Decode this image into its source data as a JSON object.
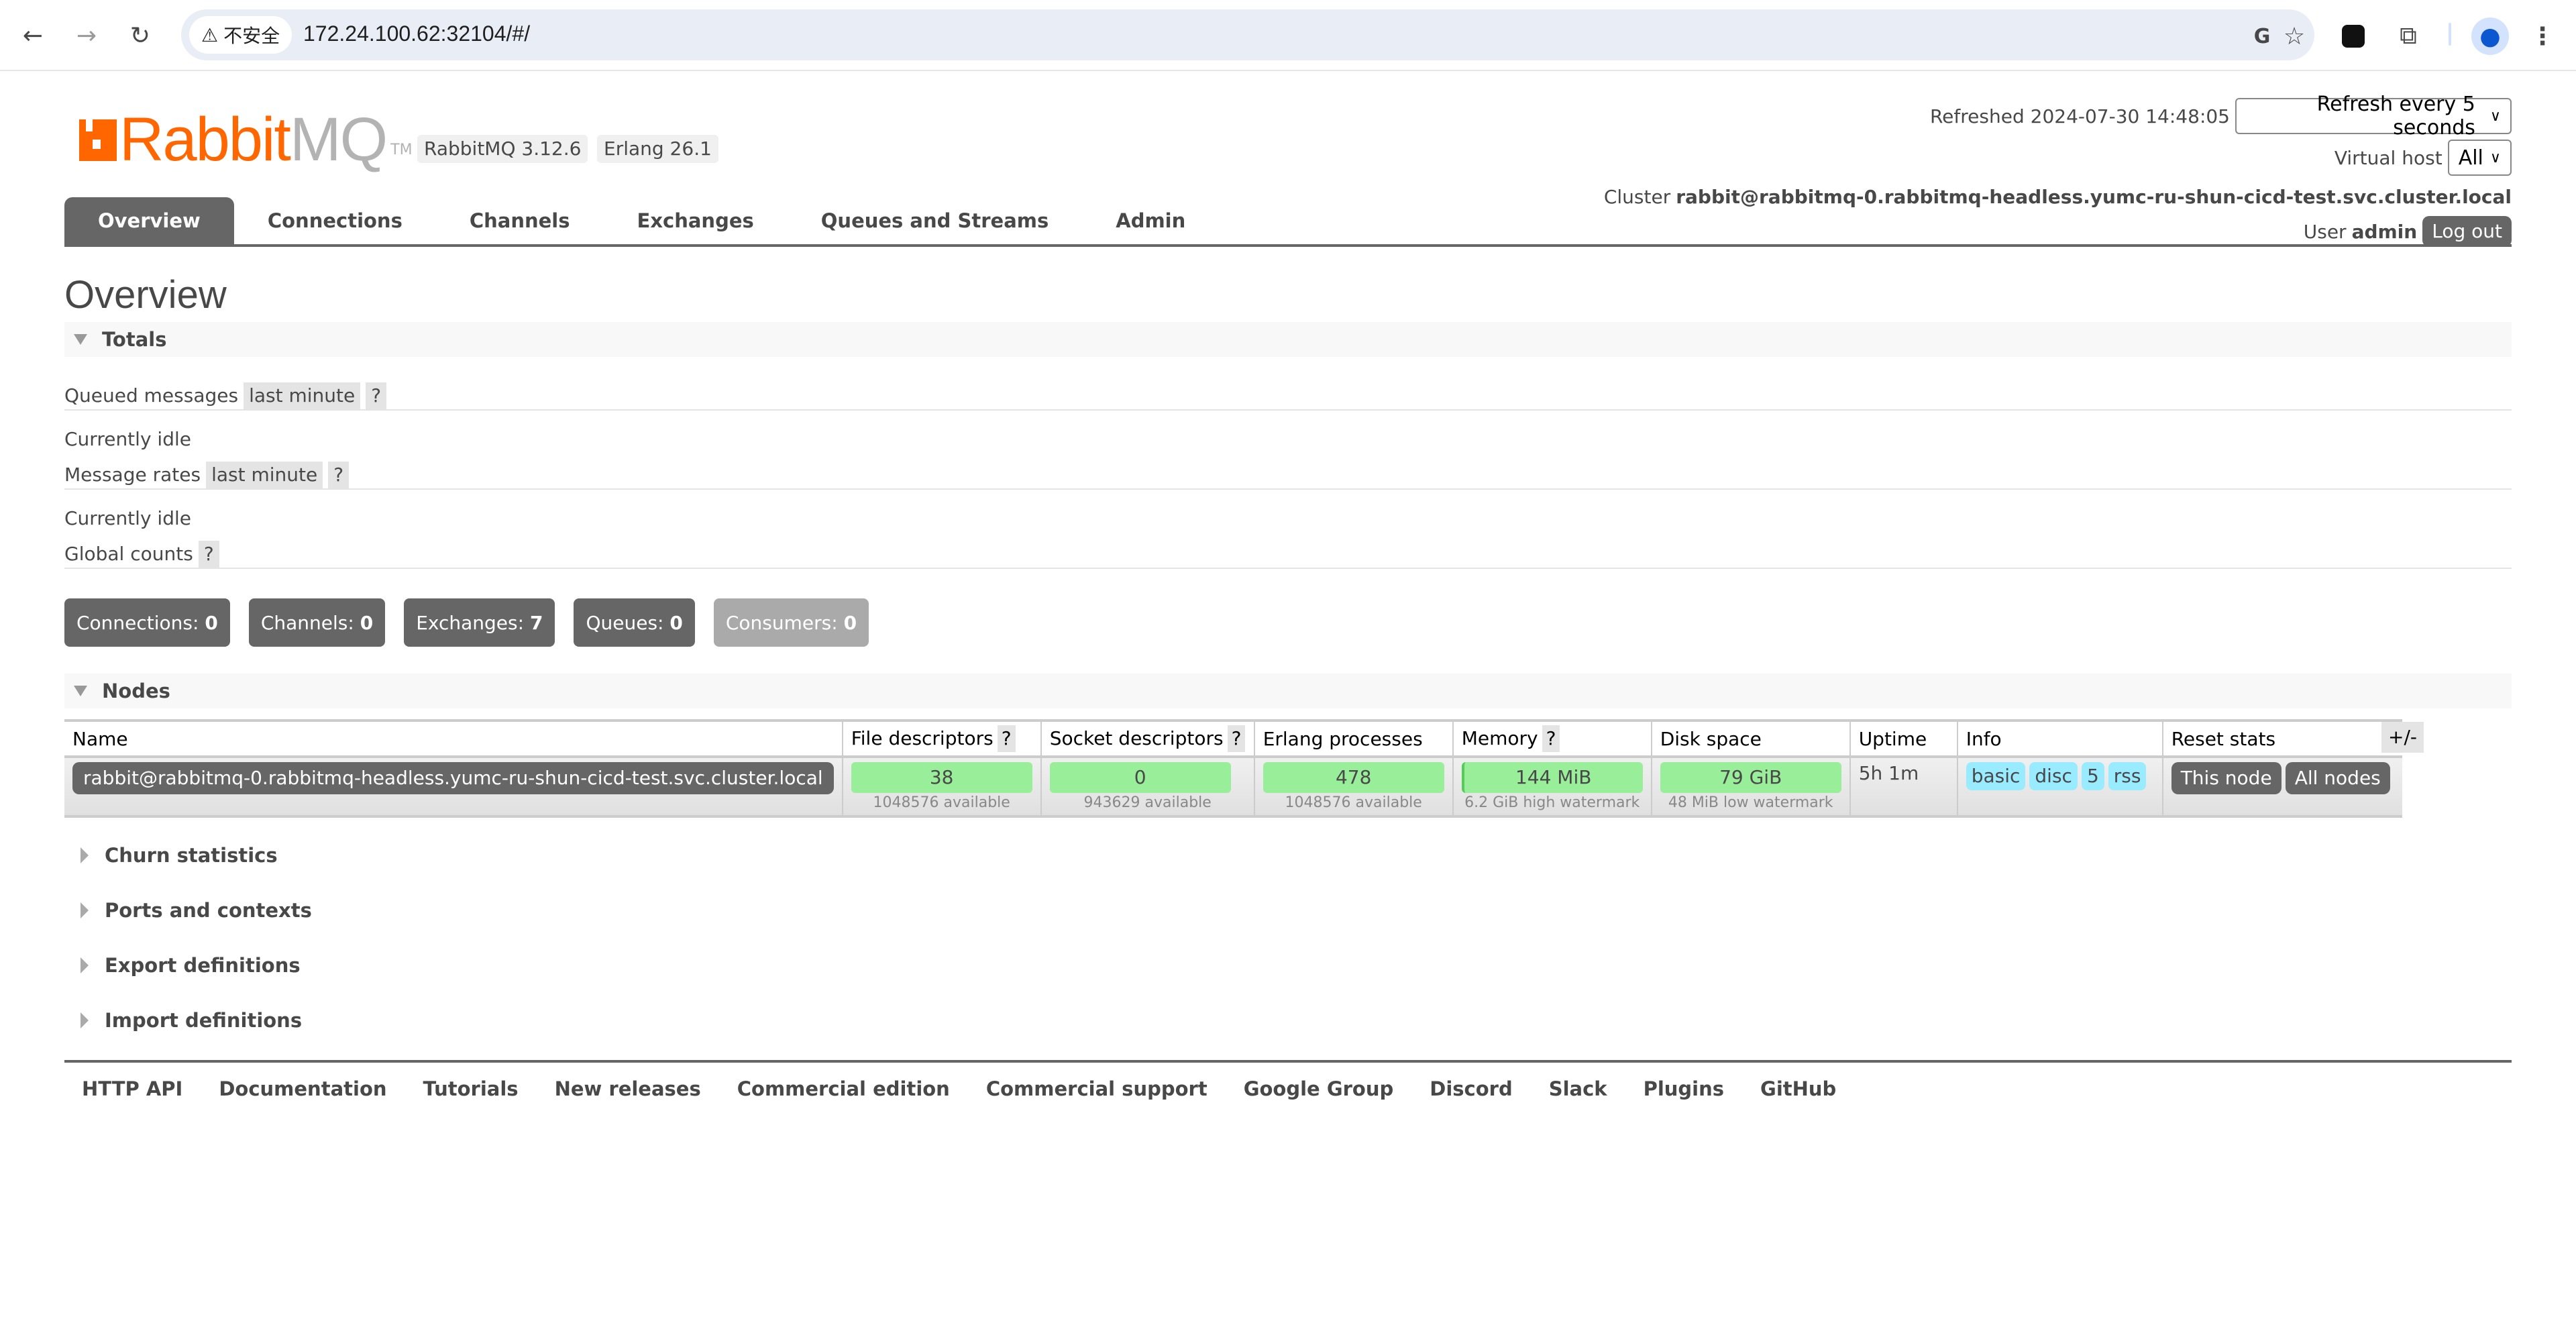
{
  "browser": {
    "security_label": "不安全",
    "url": "172.24.100.62:32104/#/",
    "icons": [
      "back-icon",
      "forward-icon",
      "reload-icon",
      "warning-icon",
      "translate-icon",
      "bookmark-star-icon",
      "extension-app-icon",
      "extensions-puzzle-icon",
      "profile-icon",
      "menu-dots-icon"
    ]
  },
  "header": {
    "logo_rabbit": "Rabbit",
    "logo_mq": "MQ",
    "logo_tm": "TM",
    "version_rabbitmq": "RabbitMQ 3.12.6",
    "version_erlang": "Erlang 26.1",
    "refreshed_label": "Refreshed 2024-07-30 14:48:05",
    "refresh_select": "Refresh every 5 seconds",
    "vhost_label": "Virtual host",
    "vhost_select": "All",
    "cluster_label": "Cluster",
    "cluster_name": "rabbit@rabbitmq-0.rabbitmq-headless.yumc-ru-shun-cicd-test.svc.cluster.local",
    "user_label": "User",
    "user_name": "admin",
    "logout_label": "Log out"
  },
  "tabs": [
    {
      "label": "Overview",
      "active": true
    },
    {
      "label": "Connections"
    },
    {
      "label": "Channels"
    },
    {
      "label": "Exchanges"
    },
    {
      "label": "Queues and Streams"
    },
    {
      "label": "Admin"
    }
  ],
  "page_title": "Overview",
  "totals": {
    "title": "Totals",
    "queued_messages_label": "Queued messages",
    "queued_messages_range": "last minute",
    "help": "?",
    "queued_status": "Currently idle",
    "message_rates_label": "Message rates",
    "message_rates_range": "last minute",
    "rates_status": "Currently idle",
    "global_counts_label": "Global counts",
    "counts": [
      {
        "label": "Connections:",
        "value": "0"
      },
      {
        "label": "Channels:",
        "value": "0"
      },
      {
        "label": "Exchanges:",
        "value": "7"
      },
      {
        "label": "Queues:",
        "value": "0"
      },
      {
        "label": "Consumers:",
        "value": "0"
      }
    ]
  },
  "nodes": {
    "title": "Nodes",
    "columns": [
      "Name",
      "File descriptors",
      "Socket descriptors",
      "Erlang processes",
      "Memory",
      "Disk space",
      "Uptime",
      "Info",
      "Reset stats"
    ],
    "toggle_columns": "+/-",
    "rows": [
      {
        "name": "rabbit@rabbitmq-0.rabbitmq-headless.yumc-ru-shun-cicd-test.svc.cluster.local",
        "file_descriptors": "38",
        "file_descriptors_sub": "1048576 available",
        "socket_descriptors": "0",
        "socket_descriptors_sub": "943629 available",
        "erlang_processes": "478",
        "erlang_processes_sub": "1048576 available",
        "memory": "144 MiB",
        "memory_sub": "6.2 GiB high watermark",
        "disk_space": "79 GiB",
        "disk_space_sub": "48 MiB low watermark",
        "uptime": "5h 1m",
        "info": [
          "basic",
          "disc",
          "5",
          "rss"
        ],
        "reset_this": "This node",
        "reset_all": "All nodes"
      }
    ]
  },
  "collapsed_sections": [
    "Churn statistics",
    "Ports and contexts",
    "Export definitions",
    "Import definitions"
  ],
  "footer_links": [
    "HTTP API",
    "Documentation",
    "Tutorials",
    "New releases",
    "Commercial edition",
    "Commercial support",
    "Google Group",
    "Discord",
    "Slack",
    "Plugins",
    "GitHub"
  ],
  "colors": {
    "brand_orange": "#ff6600",
    "tab_active": "#666666",
    "bar_green": "#99ee99",
    "info_blue": "#99ebff"
  }
}
